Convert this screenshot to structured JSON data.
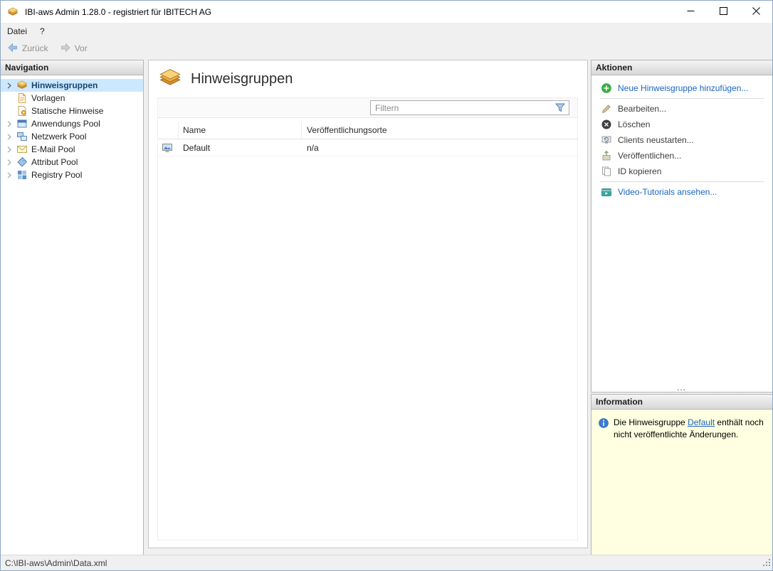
{
  "window": {
    "title": "IBI-aws Admin 1.28.0 - registriert für IBITECH AG"
  },
  "menu": {
    "items": [
      {
        "label": "Datei"
      },
      {
        "label": "?"
      }
    ]
  },
  "toolbar": {
    "back_label": "Zurück",
    "forward_label": "Vor"
  },
  "navigation": {
    "header": "Navigation",
    "items": [
      {
        "label": "Hinweisgruppen",
        "icon": "hinweisgruppen-icon",
        "selected": true,
        "expandable": true
      },
      {
        "label": "Vorlagen",
        "icon": "vorlagen-icon",
        "selected": false,
        "expandable": false
      },
      {
        "label": "Statische Hinweise",
        "icon": "statische-hinweise-icon",
        "selected": false,
        "expandable": false
      },
      {
        "label": "Anwendungs Pool",
        "icon": "anwendungs-pool-icon",
        "selected": false,
        "expandable": true
      },
      {
        "label": "Netzwerk Pool",
        "icon": "netzwerk-pool-icon",
        "selected": false,
        "expandable": true
      },
      {
        "label": "E-Mail Pool",
        "icon": "email-pool-icon",
        "selected": false,
        "expandable": true
      },
      {
        "label": "Attribut Pool",
        "icon": "attribut-pool-icon",
        "selected": false,
        "expandable": true
      },
      {
        "label": "Registry Pool",
        "icon": "registry-pool-icon",
        "selected": false,
        "expandable": true
      }
    ]
  },
  "main": {
    "title": "Hinweisgruppen",
    "filter": {
      "placeholder": "Filtern"
    },
    "table": {
      "columns": [
        "Name",
        "Veröffentlichungsorte"
      ],
      "rows": [
        {
          "icon": "notice-group-row-icon",
          "name": "Default",
          "veroeffentlichungsorte": "n/a"
        }
      ]
    }
  },
  "actions": {
    "header": "Aktionen",
    "items": [
      {
        "label": "Neue Hinweisgruppe hinzufügen...",
        "icon": "add-icon",
        "style": "link"
      },
      {
        "label": "Bearbeiten...",
        "icon": "edit-icon",
        "style": "normal"
      },
      {
        "label": "Löschen",
        "icon": "delete-icon",
        "style": "normal"
      },
      {
        "label": "Clients neustarten...",
        "icon": "restart-clients-icon",
        "style": "normal"
      },
      {
        "label": "Veröffentlichen...",
        "icon": "publish-icon",
        "style": "normal"
      },
      {
        "label": "ID kopieren",
        "icon": "copy-id-icon",
        "style": "normal"
      },
      {
        "label": "Video-Tutorials ansehen...",
        "icon": "video-tutorials-icon",
        "style": "link"
      }
    ],
    "overflow_indicator": "…"
  },
  "information": {
    "header": "Information",
    "text_before": "Die Hinweisgruppe ",
    "link_text": "Default",
    "text_after": " enthält noch nicht veröffentlichte Änderungen."
  },
  "statusbar": {
    "path": "C:\\IBI-aws\\Admin\\Data.xml"
  },
  "colors": {
    "link_blue": "#1a66c2",
    "selection_bg": "#cce8ff",
    "info_bg": "#ffffe1"
  }
}
